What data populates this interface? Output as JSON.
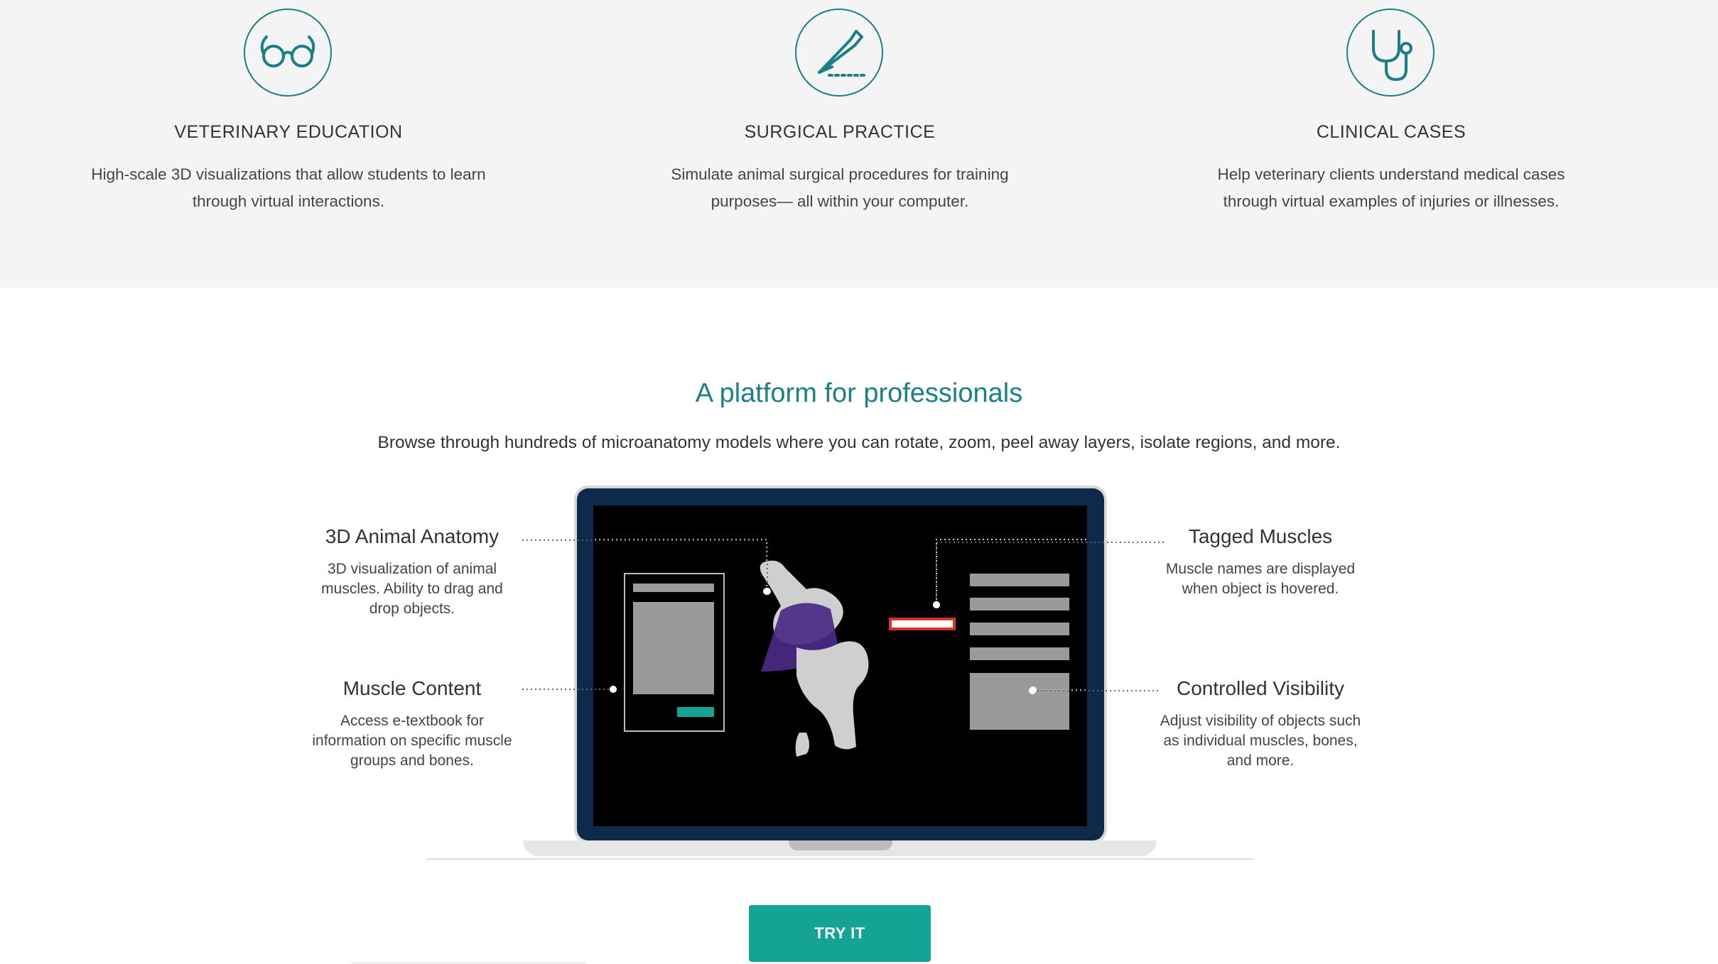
{
  "colors": {
    "accent": "#1a7f87",
    "button": "#14a394",
    "highlight": "#d9312b",
    "violet": "#4a2a86"
  },
  "features": [
    {
      "icon": "glasses-icon",
      "title": "VETERINARY EDUCATION",
      "desc": "High-scale 3D visualizations that allow students to learn through virtual interactions."
    },
    {
      "icon": "scalpel-icon",
      "title": "SURGICAL PRACTICE",
      "desc": "Simulate animal surgical procedures for training purposes— all within your computer."
    },
    {
      "icon": "stethoscope-icon",
      "title": "CLINICAL CASES",
      "desc": "Help veterinary clients understand   medical cases through virtual examples of injuries or illnesses."
    }
  ],
  "platform": {
    "title": "A platform for professionals",
    "subtitle": "Browse through hundreds of microanatomy models where you can rotate, zoom, peel away layers, isolate regions, and more."
  },
  "callouts": {
    "anatomy": {
      "title": "3D Animal Anatomy",
      "desc": "3D visualization of animal muscles. Ability to drag and drop objects."
    },
    "content": {
      "title": "Muscle Content",
      "desc": "Access e-textbook for information on specific muscle groups and bones."
    },
    "tagged": {
      "title": "Tagged Muscles",
      "desc": "Muscle names are displayed when object is hovered."
    },
    "visibility": {
      "title": "Controlled Visibility",
      "desc": "Adjust visibility of objects such as individual muscles, bones, and more."
    }
  },
  "cta": {
    "label": "TRY IT"
  }
}
